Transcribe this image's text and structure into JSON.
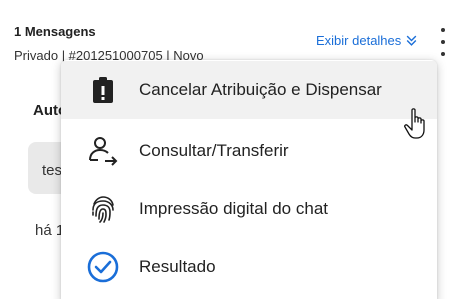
{
  "header": {
    "message_count": "1 Mensagens",
    "subtitle": "Privado | #201251000705 | Novo",
    "details_link": "Exibir detalhes"
  },
  "background": {
    "author": "Autor",
    "bubble_text": "teste",
    "time": "há 1 minuto"
  },
  "menu": {
    "items": [
      {
        "label": "Cancelar Atribuição e Dispensar",
        "icon": "clipboard-alert-icon"
      },
      {
        "label": "Consultar/Transferir",
        "icon": "user-transfer-icon"
      },
      {
        "label": "Impressão digital do chat",
        "icon": "fingerprint-icon"
      },
      {
        "label": "Resultado",
        "icon": "check-circle-icon"
      }
    ]
  },
  "colors": {
    "link": "#1a6ed8",
    "check_icon": "#1a6ed8",
    "hover_bg": "#f1f1f1"
  }
}
